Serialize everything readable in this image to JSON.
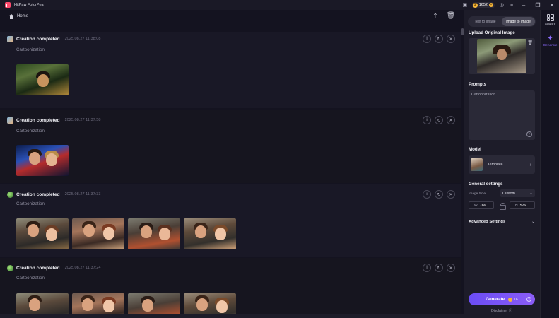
{
  "app": {
    "name": "HitPaw FotorPea"
  },
  "titlebar": {
    "coins": "1652"
  },
  "nav": {
    "home_label": "Home"
  },
  "feed": {
    "cards": [
      {
        "title": "Creation completed",
        "time": "2025.08.27  11:38:08",
        "label": "Cartoonization",
        "count": 1
      },
      {
        "title": "Creation completed",
        "time": "2025.08.27  11:37:58",
        "label": "Cartoonization",
        "count": 1
      },
      {
        "title": "Creation completed",
        "time": "2025.08.27  11:37:33",
        "label": "Cartoonization",
        "count": 4
      },
      {
        "title": "Creation completed",
        "time": "2025.08.27  11:37:24",
        "label": "Cartoonization",
        "count": 4
      }
    ]
  },
  "panel": {
    "tabs": [
      "Text to Image",
      "Image to Image"
    ],
    "active_tab": "Image to Image",
    "upload_heading": "Upload Original Image",
    "prompts_heading": "Prompts",
    "prompt_text": "Cartoonization",
    "model_heading": "Model",
    "model_name": "Template",
    "general_heading": "General settings",
    "image_size_label": "Image Size",
    "image_size_value": "Custom",
    "width_key": "W",
    "width_value": "766",
    "height_key": "H",
    "height_value": "526",
    "advanced_label": "Advanced Settings",
    "generate_label": "Generate",
    "generate_cost": "16",
    "disclaimer": "Disclaimer"
  },
  "rail": {
    "items": [
      {
        "label": "Square",
        "icon": "grid-icon",
        "active": false
      },
      {
        "label": "Generate",
        "icon": "sparkle-icon",
        "active": true
      }
    ]
  },
  "colors": {
    "accent": "#7b55f6",
    "coin": "#f3b53a",
    "background": "#141320"
  }
}
